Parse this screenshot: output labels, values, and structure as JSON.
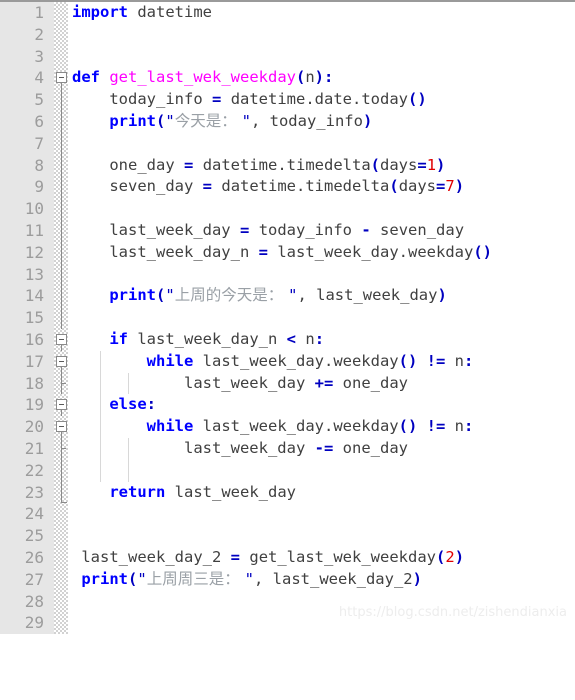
{
  "editor": {
    "language": "python",
    "total_lines": 29,
    "first_visible_line": 1,
    "last_visible_line": 29,
    "background_color": "#ffffff",
    "gutter_color": "#e6e6e6",
    "lineno_color": "#9c9c9c"
  },
  "syntax_colors": {
    "keyword": "#0000ff",
    "function_name": "#ff00ff",
    "punctuation": "#0000c0",
    "operator": "#0000c0",
    "number": "#e00000",
    "string": "#0000c0",
    "cjk_string_text": "#9aa0a6",
    "plain": "#404040"
  },
  "line_numbers": [
    "1",
    "2",
    "3",
    "4",
    "5",
    "6",
    "7",
    "8",
    "9",
    "10",
    "11",
    "12",
    "13",
    "14",
    "15",
    "16",
    "17",
    "18",
    "19",
    "20",
    "21",
    "22",
    "23",
    "24",
    "25",
    "26",
    "27",
    "28",
    "29"
  ],
  "lines": [
    {
      "n": "1",
      "text": "import datetime"
    },
    {
      "n": "2",
      "text": ""
    },
    {
      "n": "3",
      "text": ""
    },
    {
      "n": "4",
      "text": "def get_last_wek_weekday(n):",
      "fold": true
    },
    {
      "n": "5",
      "text": "    today_info = datetime.date.today()"
    },
    {
      "n": "6",
      "text": "    print(\"今天是： \", today_info)"
    },
    {
      "n": "7",
      "text": ""
    },
    {
      "n": "8",
      "text": "    one_day = datetime.timedelta(days=1)"
    },
    {
      "n": "9",
      "text": "    seven_day = datetime.timedelta(days=7)"
    },
    {
      "n": "10",
      "text": ""
    },
    {
      "n": "11",
      "text": "    last_week_day = today_info - seven_day"
    },
    {
      "n": "12",
      "text": "    last_week_day_n = last_week_day.weekday()"
    },
    {
      "n": "13",
      "text": ""
    },
    {
      "n": "14",
      "text": "    print(\"上周的今天是： \", last_week_day)"
    },
    {
      "n": "15",
      "text": ""
    },
    {
      "n": "16",
      "text": "    if last_week_day_n < n:",
      "fold": true
    },
    {
      "n": "17",
      "text": "        while last_week_day.weekday() != n:",
      "fold": true
    },
    {
      "n": "18",
      "text": "            last_week_day += one_day"
    },
    {
      "n": "19",
      "text": "    else:",
      "fold": true
    },
    {
      "n": "20",
      "text": "        while last_week_day.weekday() != n:",
      "fold": true
    },
    {
      "n": "21",
      "text": "            last_week_day -= one_day"
    },
    {
      "n": "22",
      "text": ""
    },
    {
      "n": "23",
      "text": "    return last_week_day"
    },
    {
      "n": "24",
      "text": ""
    },
    {
      "n": "25",
      "text": ""
    },
    {
      "n": "26",
      "text": " last_week_day_2 = get_last_wek_weekday(2)"
    },
    {
      "n": "27",
      "text": " print(\"上周周三是： \", last_week_day_2)"
    },
    {
      "n": "28",
      "text": ""
    },
    {
      "n": "29",
      "text": ""
    }
  ],
  "tokens": {
    "l1": {
      "kw": "import",
      "sp": " ",
      "mod": "datetime"
    },
    "l4": {
      "kw": "def",
      "name": "get_last_wek_weekday",
      "open": "(",
      "arg": "n",
      "close": ")",
      "colon": ":"
    },
    "l5": {
      "var": "today_info",
      "eq": "=",
      "expr": "datetime.date.today",
      "parens": "()"
    },
    "l6": {
      "fn": "print",
      "open": "(",
      "q1": "\"",
      "cjk": "今天是： ",
      "q2": "\"",
      "comma": ", ",
      "arg": "today_info",
      "close": ")"
    },
    "l8": {
      "var": "one_day",
      "eq": "=",
      "expr": "datetime.timedelta",
      "open": "(",
      "kwarg": "days",
      "eq2": "=",
      "num": "1",
      "close": ")"
    },
    "l9": {
      "var": "seven_day",
      "eq": "=",
      "expr": "datetime.timedelta",
      "open": "(",
      "kwarg": "days",
      "eq2": "=",
      "num": "7",
      "close": ")"
    },
    "l11": {
      "var": "last_week_day",
      "eq": "=",
      "a": "today_info",
      "minus": "-",
      "b": "seven_day"
    },
    "l12": {
      "var": "last_week_day_n",
      "eq": "=",
      "expr": "last_week_day.weekday",
      "parens": "()"
    },
    "l14": {
      "fn": "print",
      "open": "(",
      "q1": "\"",
      "cjk": "上周的今天是： ",
      "q2": "\"",
      "comma": ", ",
      "arg": "last_week_day",
      "close": ")"
    },
    "l16": {
      "kw": "if",
      "expr": "last_week_day_n",
      "op": "<",
      "n": "n",
      "colon": ":"
    },
    "l17": {
      "kw": "while",
      "expr": "last_week_day.weekday",
      "parens": "()",
      "op": "!=",
      "n": "n",
      "colon": ":"
    },
    "l18": {
      "var": "last_week_day",
      "op": "+=",
      "val": "one_day"
    },
    "l19": {
      "kw": "else",
      "colon": ":"
    },
    "l20": {
      "kw": "while",
      "expr": "last_week_day.weekday",
      "parens": "()",
      "op": "!=",
      "n": "n",
      "colon": ":"
    },
    "l21": {
      "var": "last_week_day",
      "op": "-=",
      "val": "one_day"
    },
    "l23": {
      "kw": "return",
      "val": "last_week_day"
    },
    "l26": {
      "var": "last_week_day_2",
      "eq": "=",
      "fn": "get_last_wek_weekday",
      "open": "(",
      "num": "2",
      "close": ")"
    },
    "l27": {
      "fn": "print",
      "open": "(",
      "q1": "\"",
      "cjk": "上周周三是： ",
      "q2": "\"",
      "comma": ", ",
      "arg": "last_week_day_2",
      "close": ")"
    }
  },
  "watermark": {
    "text": "https://blog.csdn.net/zishendianxia"
  }
}
